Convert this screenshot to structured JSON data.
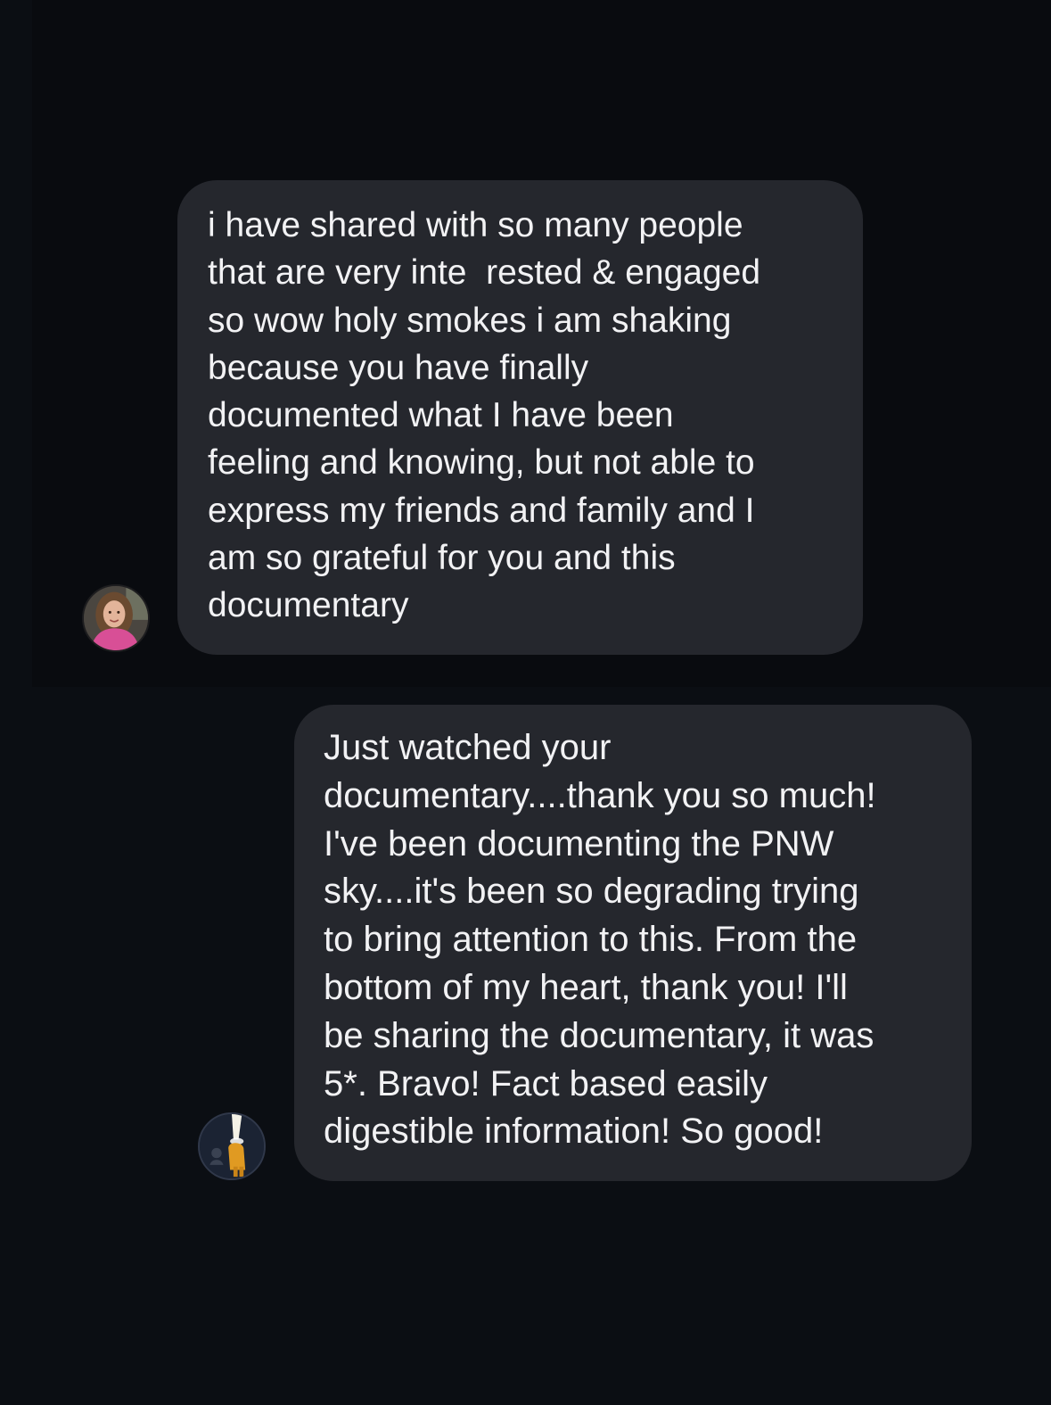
{
  "conversation": {
    "messages": [
      {
        "sender": "incoming",
        "avatar": "woman-portrait-avatar",
        "lines": [
          "i have shared with so many people",
          "that are very inte  rested & engaged",
          "so wow holy smokes i am shaking",
          "because you have finally",
          "documented what I have been",
          "feeling and knowing, but not able to",
          "express my friends and family and I",
          "am so grateful for you and this",
          "documentary"
        ]
      },
      {
        "sender": "incoming",
        "avatar": "figure-with-light-avatar",
        "lines": [
          "Just watched your",
          "documentary....thank you so much!",
          "I've been documenting the PNW",
          "sky....it's been so degrading trying",
          "to bring attention to this. From the",
          "bottom of my heart, thank you! I'll",
          "be sharing the documentary, it was",
          "5*. Bravo! Fact based easily",
          "digestible information! So good!"
        ]
      }
    ]
  },
  "colors": {
    "background": "#0b0e13",
    "bubble": "#25272d",
    "text": "#f2f2f4"
  }
}
